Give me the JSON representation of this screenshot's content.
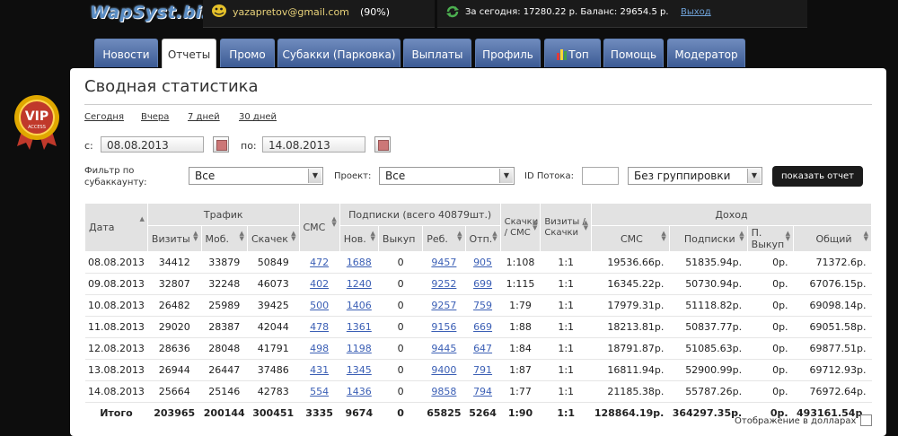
{
  "header": {
    "logo": "WapSyst.biz",
    "email": "yazapretov@gmail.com",
    "percent": "(90%)",
    "today_label": "За сегодня:",
    "today_value": "17280.22 р.",
    "balance_label": "Баланс:",
    "balance_value": "29654.5 р.",
    "logout": "Выход"
  },
  "tabs": [
    "Новости",
    "Отчеты",
    "Промо",
    "Субакки (Парковка)",
    "Выплаты",
    "Профиль",
    "Топ",
    "Помощь",
    "Модератор"
  ],
  "page": {
    "title": "Сводная статистика",
    "quick_links": [
      "Сегодня",
      "Вчера",
      "7 дней",
      "30 дней"
    ],
    "from_label": "с:",
    "from_value": "08.08.2013",
    "to_label": "по:",
    "to_value": "14.08.2013",
    "filter_label": "Фильтр по субаккаунту:",
    "filter_value": "Все",
    "project_label": "Проект:",
    "project_value": "Все",
    "stream_label": "ID Потока:",
    "stream_value": "",
    "grouping_value": "Без группировки",
    "show_button": "показать отчет",
    "usd_label": "Отображение в долларах"
  },
  "table": {
    "group_headers": {
      "date": "Дата",
      "traffic": "Трафик",
      "sms": "СМС",
      "subs": "Подписки (всего 40879шт.)",
      "dl_sms": "Скачки / СМС",
      "visits_dl": "Визиты / Скачки",
      "income": "Доход"
    },
    "sub_headers": [
      "Визиты",
      "Моб.",
      "Скачек",
      "Нов.",
      "Выкуп",
      "Реб.",
      "Отп.",
      "СМС",
      "Подписки",
      "П. Выкуп",
      "Общий"
    ],
    "rows": [
      [
        "08.08.2013",
        "34412",
        "33879",
        "50849",
        "472",
        "1688",
        "0",
        "9457",
        "905",
        "1:108",
        "1:1",
        "19536.66р.",
        "51835.94р.",
        "0р.",
        "71372.6р."
      ],
      [
        "09.08.2013",
        "32807",
        "32248",
        "46073",
        "402",
        "1240",
        "0",
        "9252",
        "699",
        "1:115",
        "1:1",
        "16345.22р.",
        "50730.94р.",
        "0р.",
        "67076.15р."
      ],
      [
        "10.08.2013",
        "26482",
        "25989",
        "39425",
        "500",
        "1406",
        "0",
        "9257",
        "759",
        "1:79",
        "1:1",
        "17979.31р.",
        "51118.82р.",
        "0р.",
        "69098.14р."
      ],
      [
        "11.08.2013",
        "29020",
        "28387",
        "42044",
        "478",
        "1361",
        "0",
        "9156",
        "669",
        "1:88",
        "1:1",
        "18213.81р.",
        "50837.77р.",
        "0р.",
        "69051.58р."
      ],
      [
        "12.08.2013",
        "28636",
        "28048",
        "41791",
        "498",
        "1198",
        "0",
        "9445",
        "647",
        "1:84",
        "1:1",
        "18791.87р.",
        "51085.63р.",
        "0р.",
        "69877.51р."
      ],
      [
        "13.08.2013",
        "26944",
        "26447",
        "37486",
        "431",
        "1345",
        "0",
        "9400",
        "791",
        "1:87",
        "1:1",
        "16811.94р.",
        "52900.99р.",
        "0р.",
        "69712.93р."
      ],
      [
        "14.08.2013",
        "25664",
        "25146",
        "42783",
        "554",
        "1436",
        "0",
        "9858",
        "794",
        "1:77",
        "1:1",
        "21185.38р.",
        "55787.26р.",
        "0р.",
        "76972.64р."
      ]
    ],
    "total": [
      "Итого",
      "203965",
      "200144",
      "300451",
      "3335",
      "9674",
      "0",
      "65825",
      "5264",
      "1:90",
      "1:1",
      "128864.19р.",
      "364297.35р.",
      "0р.",
      "493161.54р."
    ]
  }
}
